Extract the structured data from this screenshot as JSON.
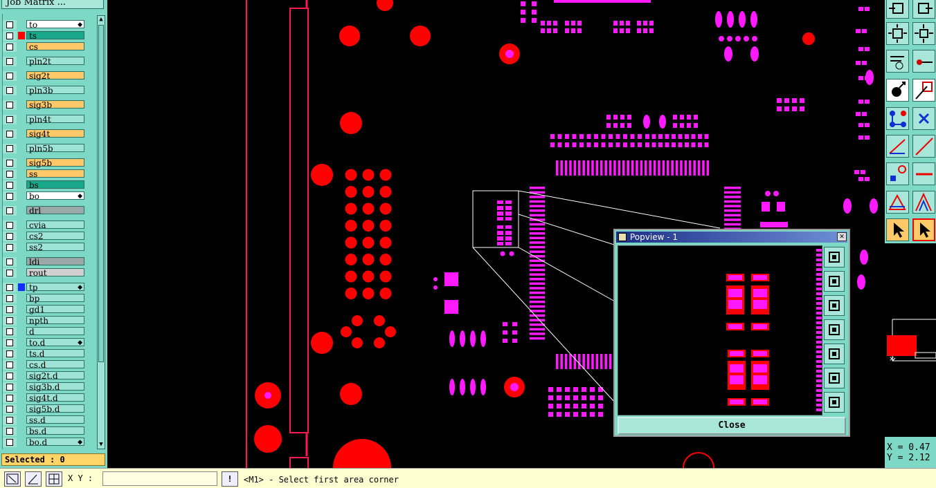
{
  "app": {
    "panel_title": "Job Matrix ..."
  },
  "layers": [
    {
      "name": "to",
      "color": "#ffffff",
      "marker": "",
      "icon": true
    },
    {
      "name": "ts",
      "color": "#1aa88a",
      "marker": "#ff0000"
    },
    {
      "name": "cs",
      "color": "#ffc96a",
      "marker": ""
    },
    {
      "name": "pln2t",
      "color": "#9ee4d6",
      "marker": ""
    },
    {
      "name": "sig2t",
      "color": "#ffc96a",
      "marker": ""
    },
    {
      "name": "pln3b",
      "color": "#9ee4d6",
      "marker": ""
    },
    {
      "name": "sig3b",
      "color": "#ffc96a",
      "marker": ""
    },
    {
      "name": "pln4t",
      "color": "#9ee4d6",
      "marker": ""
    },
    {
      "name": "sig4t",
      "color": "#ffc96a",
      "marker": ""
    },
    {
      "name": "pln5b",
      "color": "#9ee4d6",
      "marker": ""
    },
    {
      "name": "sig5b",
      "color": "#ffc96a",
      "marker": ""
    },
    {
      "name": "ss",
      "color": "#ffc96a",
      "marker": ""
    },
    {
      "name": "bs",
      "color": "#1aa88a",
      "marker": ""
    },
    {
      "name": "bo",
      "color": "#ffffff",
      "marker": "",
      "icon": true
    },
    {
      "name": "drl",
      "color": "#9aa8a8",
      "marker": ""
    },
    {
      "name": "cvia",
      "color": "#9ee4d6",
      "marker": ""
    },
    {
      "name": "cs2",
      "color": "#9ee4d6",
      "marker": ""
    },
    {
      "name": "ss2",
      "color": "#9ee4d6",
      "marker": ""
    },
    {
      "name": "ldi",
      "color": "#9aa8a8",
      "marker": ""
    },
    {
      "name": "rout",
      "color": "#d0d0d0",
      "marker": ""
    },
    {
      "name": "tp",
      "color": "#9ee4d6",
      "marker": "#1030ff",
      "icon": true
    },
    {
      "name": "bp",
      "color": "#9ee4d6",
      "marker": ""
    },
    {
      "name": "gd1",
      "color": "#9ee4d6",
      "marker": ""
    },
    {
      "name": "npth",
      "color": "#9ee4d6",
      "marker": ""
    },
    {
      "name": "d",
      "color": "#9ee4d6",
      "marker": ""
    },
    {
      "name": "to.d",
      "color": "#9ee4d6",
      "marker": "",
      "icon": true
    },
    {
      "name": "ts.d",
      "color": "#9ee4d6",
      "marker": ""
    },
    {
      "name": "cs.d",
      "color": "#9ee4d6",
      "marker": ""
    },
    {
      "name": "sig2t.d",
      "color": "#9ee4d6",
      "marker": ""
    },
    {
      "name": "sig3b.d",
      "color": "#9ee4d6",
      "marker": ""
    },
    {
      "name": "sig4t.d",
      "color": "#9ee4d6",
      "marker": ""
    },
    {
      "name": "sig5b.d",
      "color": "#9ee4d6",
      "marker": ""
    },
    {
      "name": "ss.d",
      "color": "#9ee4d6",
      "marker": ""
    },
    {
      "name": "bs.d",
      "color": "#9ee4d6",
      "marker": ""
    },
    {
      "name": "bo.d",
      "color": "#9ee4d6",
      "marker": "",
      "icon": true
    }
  ],
  "status": {
    "selected": "Selected : 0"
  },
  "bottom": {
    "xy_label": "X Y :",
    "xy_value": "",
    "message": "<M1> - Select first area corner"
  },
  "coords": {
    "x": "X = 0.47",
    "y": "Y = 2.12"
  },
  "popview": {
    "title": "Popview - 1",
    "close_label": "Close"
  },
  "colors": {
    "pad_red": "#ff0000",
    "pad_magenta": "#ff1aff",
    "panel": "#7ed8c6"
  }
}
